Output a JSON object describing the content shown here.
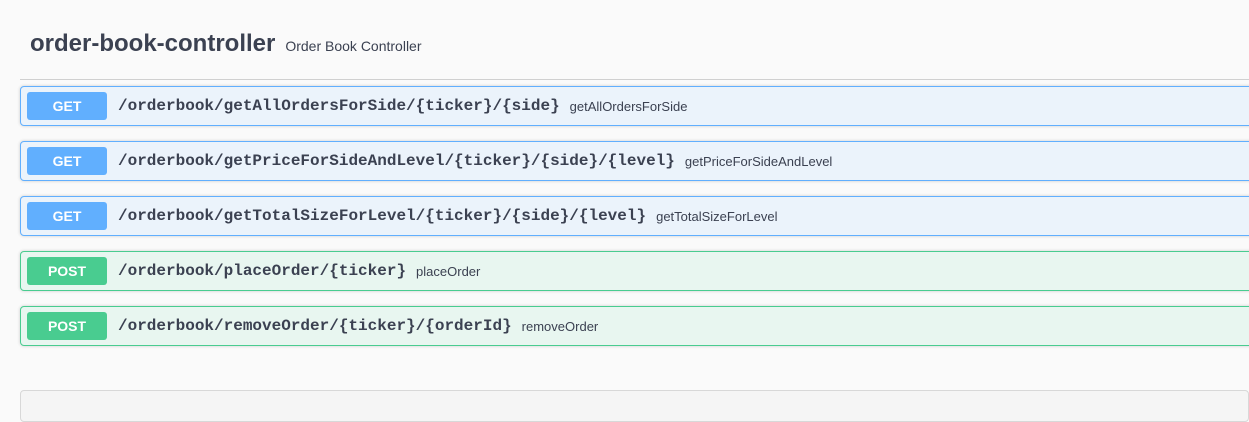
{
  "tag": {
    "name": "order-book-controller",
    "description": "Order Book Controller"
  },
  "colors": {
    "get": "#61affe",
    "post": "#49cc90"
  },
  "operations": [
    {
      "method": "GET",
      "path": "/orderbook/getAllOrdersForSide/{ticker}/{side}",
      "summary": "getAllOrdersForSide"
    },
    {
      "method": "GET",
      "path": "/orderbook/getPriceForSideAndLevel/{ticker}/{side}/{level}",
      "summary": "getPriceForSideAndLevel"
    },
    {
      "method": "GET",
      "path": "/orderbook/getTotalSizeForLevel/{ticker}/{side}/{level}",
      "summary": "getTotalSizeForLevel"
    },
    {
      "method": "POST",
      "path": "/orderbook/placeOrder/{ticker}",
      "summary": "placeOrder"
    },
    {
      "method": "POST",
      "path": "/orderbook/removeOrder/{ticker}/{orderId}",
      "summary": "removeOrder"
    }
  ]
}
